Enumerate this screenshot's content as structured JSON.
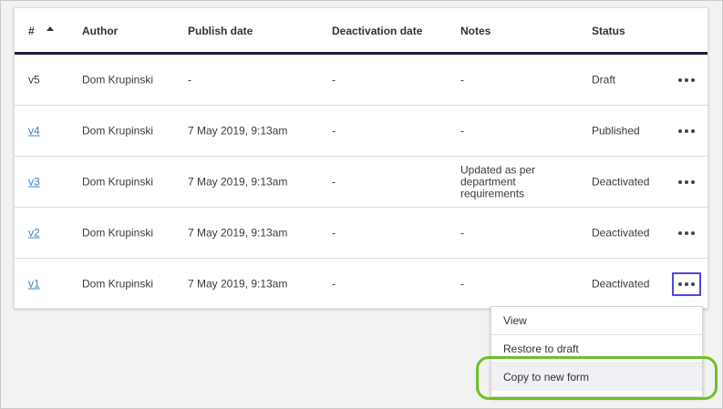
{
  "table": {
    "headers": {
      "version": "#",
      "author": "Author",
      "publish_date": "Publish date",
      "deactivation_date": "Deactivation date",
      "notes": "Notes",
      "status": "Status"
    },
    "rows": [
      {
        "version": "v5",
        "version_is_link": false,
        "author": "Dom Krupinski",
        "publish_date": "-",
        "deactivation_date": "-",
        "notes": "-",
        "status": "Draft"
      },
      {
        "version": "v4",
        "version_is_link": true,
        "author": "Dom Krupinski",
        "publish_date": "7 May 2019, 9:13am",
        "deactivation_date": "-",
        "notes": "-",
        "status": "Published"
      },
      {
        "version": "v3",
        "version_is_link": true,
        "author": "Dom Krupinski",
        "publish_date": "7 May 2019, 9:13am",
        "deactivation_date": "-",
        "notes": "Updated as per department requirements",
        "status": "Deactivated"
      },
      {
        "version": "v2",
        "version_is_link": true,
        "author": "Dom Krupinski",
        "publish_date": "7 May 2019, 9:13am",
        "deactivation_date": "-",
        "notes": "-",
        "status": "Deactivated"
      },
      {
        "version": "v1",
        "version_is_link": true,
        "author": "Dom Krupinski",
        "publish_date": "7 May 2019, 9:13am",
        "deactivation_date": "-",
        "notes": "-",
        "status": "Deactivated"
      }
    ]
  },
  "context_menu": {
    "items": [
      "View",
      "Restore to draft",
      "Copy to new form"
    ]
  },
  "colors": {
    "link": "#3b84c8",
    "header_rule": "#1c1c3a",
    "focus_ring": "#5048d8",
    "callout": "#6cc125"
  }
}
